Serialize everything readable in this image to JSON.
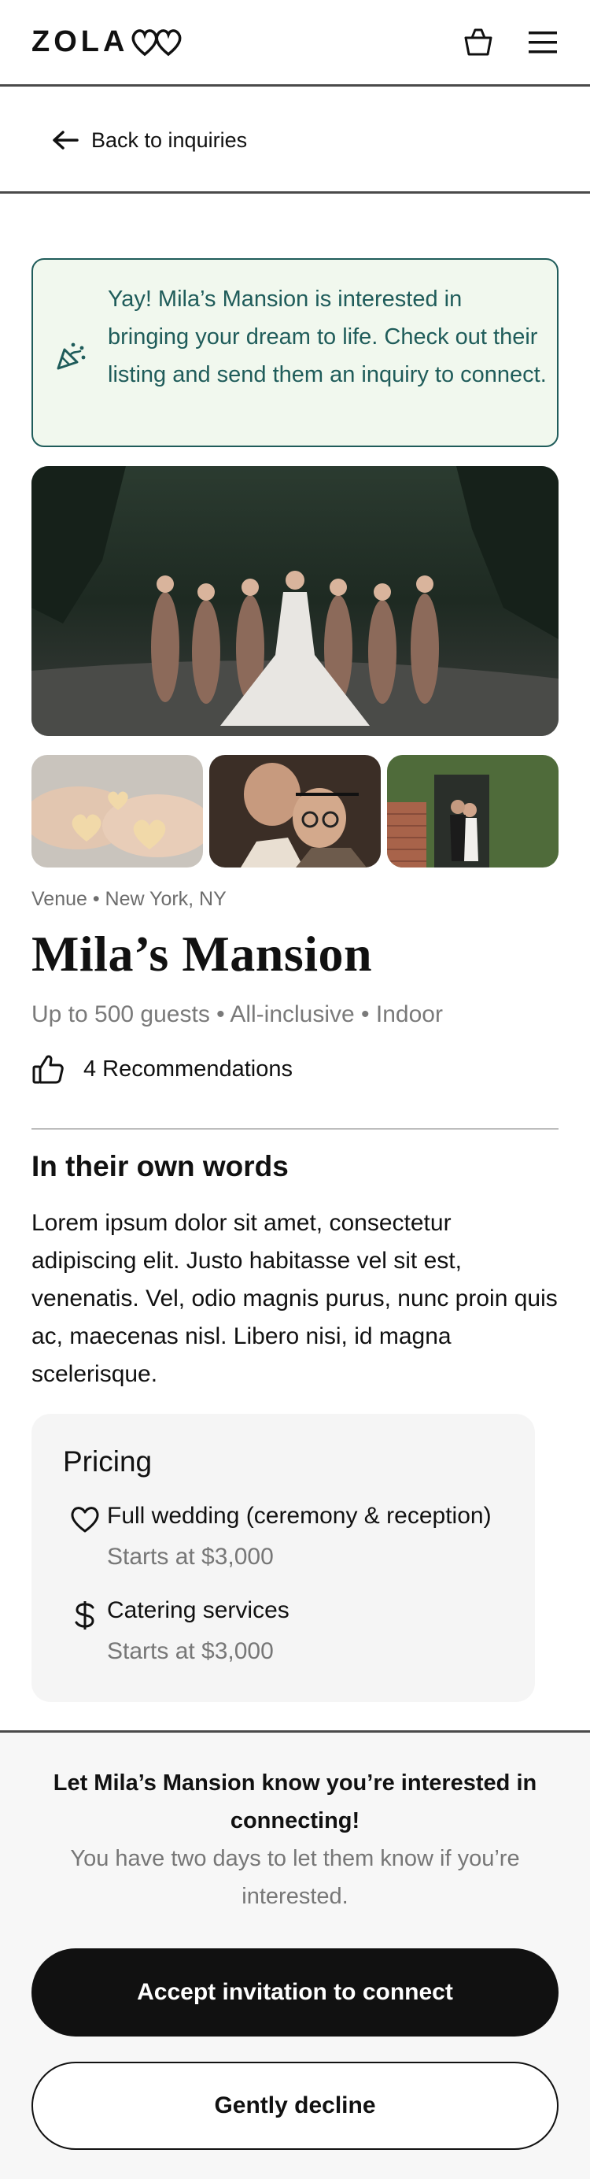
{
  "header": {
    "logo_text": "ZOLA",
    "logo_icon": "hearts-logo-icon",
    "cart_icon": "basket-icon",
    "menu_icon": "hamburger-menu-icon"
  },
  "nav": {
    "back_label": "Back to inquiries",
    "back_icon": "arrow-left-icon"
  },
  "banner": {
    "icon": "party-popper-icon",
    "text": "Yay! Mila’s Mansion is interested in bringing your dream to life. Check out their listing and send them an inquiry to connect."
  },
  "gallery": {
    "hero_alt": "bridal-party-photo",
    "thumbnails": [
      "heart-cookies-photo",
      "couple-portrait-photo",
      "ivy-wall-couple-photo"
    ]
  },
  "listing": {
    "meta": "Venue • New York, NY",
    "name": "Mila’s Mansion",
    "specs": "Up to 500 guests • All-inclusive • Indoor",
    "recommendations": "4 Recommendations",
    "recommendations_icon": "thumbs-up-icon"
  },
  "about": {
    "heading": "In their own words",
    "text": "Lorem ipsum dolor sit amet, consectetur adipiscing elit. Justo habitasse vel sit est, venenatis. Vel, odio magnis purus, nunc proin quis ac, maecenas nisl. Libero nisi, id magna scelerisque."
  },
  "pricing": {
    "heading": "Pricing",
    "items": [
      {
        "icon": "heart-icon",
        "name": "Full wedding (ceremony & reception)",
        "price": "Starts at $3,000"
      },
      {
        "icon": "dollar-icon",
        "name": "Catering services",
        "price": "Starts at $3,000"
      }
    ]
  },
  "footer": {
    "title": "Let Mila’s Mansion know you’re interested in connecting!",
    "subtitle": "You have two days to let them know if you’re interested.",
    "accept_label": "Accept invitation to connect",
    "decline_label": "Gently decline"
  },
  "colors": {
    "accent_teal": "#1f5c5a",
    "banner_bg": "#f1f8ee",
    "primary_button": "#111111"
  }
}
